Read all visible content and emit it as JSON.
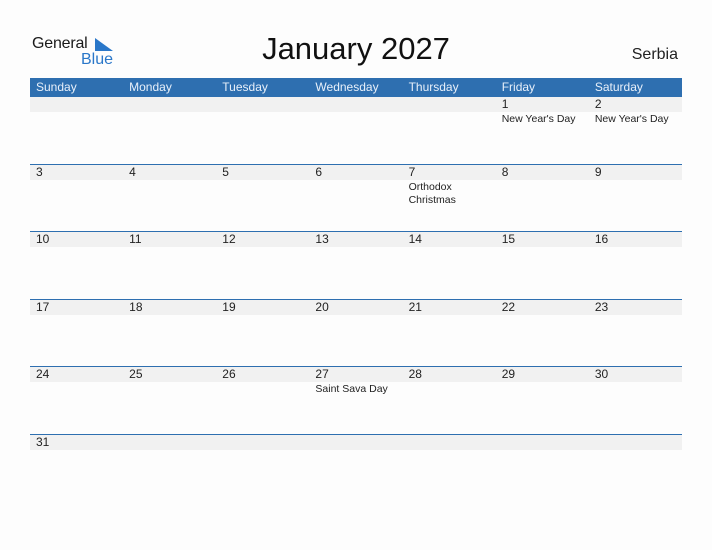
{
  "logo": {
    "word1": "General",
    "word2": "Blue"
  },
  "title": "January 2027",
  "country": "Serbia",
  "colors": {
    "header_bg": "#2e6fb0",
    "brand_blue": "#2a77c9",
    "band_bg": "#f1f1f1"
  },
  "weekdays": [
    "Sunday",
    "Monday",
    "Tuesday",
    "Wednesday",
    "Thursday",
    "Friday",
    "Saturday"
  ],
  "weeks": [
    [
      {
        "d": "",
        "h": ""
      },
      {
        "d": "",
        "h": ""
      },
      {
        "d": "",
        "h": ""
      },
      {
        "d": "",
        "h": ""
      },
      {
        "d": "",
        "h": ""
      },
      {
        "d": "1",
        "h": "New Year's Day"
      },
      {
        "d": "2",
        "h": "New Year's Day"
      }
    ],
    [
      {
        "d": "3",
        "h": ""
      },
      {
        "d": "4",
        "h": ""
      },
      {
        "d": "5",
        "h": ""
      },
      {
        "d": "6",
        "h": ""
      },
      {
        "d": "7",
        "h": "Orthodox Christmas"
      },
      {
        "d": "8",
        "h": ""
      },
      {
        "d": "9",
        "h": ""
      }
    ],
    [
      {
        "d": "10",
        "h": ""
      },
      {
        "d": "11",
        "h": ""
      },
      {
        "d": "12",
        "h": ""
      },
      {
        "d": "13",
        "h": ""
      },
      {
        "d": "14",
        "h": ""
      },
      {
        "d": "15",
        "h": ""
      },
      {
        "d": "16",
        "h": ""
      }
    ],
    [
      {
        "d": "17",
        "h": ""
      },
      {
        "d": "18",
        "h": ""
      },
      {
        "d": "19",
        "h": ""
      },
      {
        "d": "20",
        "h": ""
      },
      {
        "d": "21",
        "h": ""
      },
      {
        "d": "22",
        "h": ""
      },
      {
        "d": "23",
        "h": ""
      }
    ],
    [
      {
        "d": "24",
        "h": ""
      },
      {
        "d": "25",
        "h": ""
      },
      {
        "d": "26",
        "h": ""
      },
      {
        "d": "27",
        "h": "Saint Sava Day"
      },
      {
        "d": "28",
        "h": ""
      },
      {
        "d": "29",
        "h": ""
      },
      {
        "d": "30",
        "h": ""
      }
    ],
    [
      {
        "d": "31",
        "h": ""
      },
      {
        "d": "",
        "h": ""
      },
      {
        "d": "",
        "h": ""
      },
      {
        "d": "",
        "h": ""
      },
      {
        "d": "",
        "h": ""
      },
      {
        "d": "",
        "h": ""
      },
      {
        "d": "",
        "h": ""
      }
    ]
  ]
}
